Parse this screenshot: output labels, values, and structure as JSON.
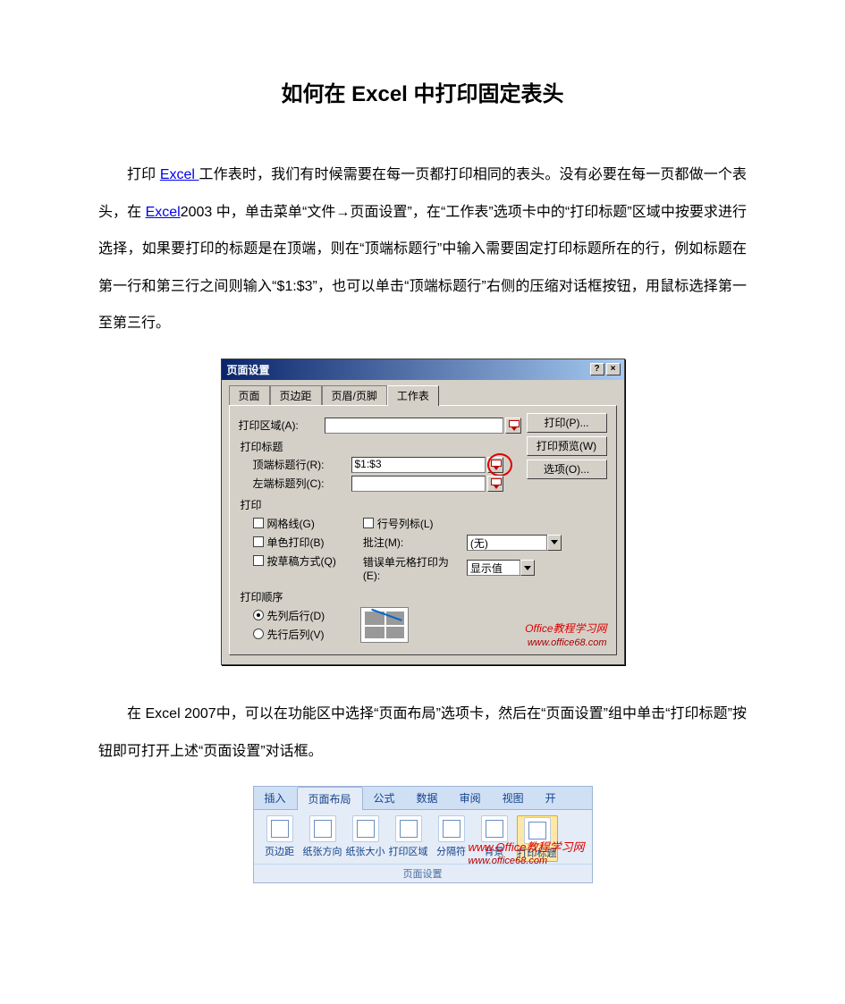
{
  "doc": {
    "title": "如何在 Excel 中打印固定表头",
    "p1_a": "打印 ",
    "p1_link1": "Excel ",
    "p1_b": "工作表时，我们有时候需要在每一页都打印相同的表头。没有必要在每一页都做一个表头，在 ",
    "p1_link2": "Excel",
    "p1_c": "2003 中，单击菜单“文件→页面设置”，在“工作表”选项卡中的“打印标题”区域中按要求进行选择，如果要打印的标题是在顶端，则在“顶端标题行”中输入需要固定打印标题所在的行，例如标题在第一行和第三行之间则输入“$1:$3”，也可以单击“顶端标题行”右侧的压缩对话框按钮，用鼠标选择第一至第三行。",
    "p2": "在 Excel  2007中，可以在功能区中选择“页面布局”选项卡，然后在“页面设置”组中单击“打印标题”按钮即可打开上述“页面设置”对话框。"
  },
  "dialog": {
    "title": "页面设置",
    "help_btn": "?",
    "close_btn": "×",
    "tabs": [
      "页面",
      "页边距",
      "页眉/页脚",
      "工作表"
    ],
    "active_tab": 3,
    "print_area_label": "打印区域(A):",
    "section_titles": "打印标题",
    "top_row_label": "顶端标题行(R):",
    "top_row_value": "$1:$3",
    "left_col_label": "左端标题列(C):",
    "section_print": "打印",
    "cb_grid": "网格线(G)",
    "cb_mono": "单色打印(B)",
    "cb_draft": "按草稿方式(Q)",
    "cb_rowcol": "行号列标(L)",
    "comment_label": "批注(M):",
    "comment_value": "(无)",
    "error_label": "错误单元格打印为(E):",
    "error_value": "显示值",
    "section_order": "打印顺序",
    "radio_down": "先列后行(D)",
    "radio_over": "先行后列(V)",
    "btn_print": "打印(P)...",
    "btn_preview": "打印预览(W)",
    "btn_options": "选项(O)...",
    "watermark_main": "Office教程学习网",
    "watermark_sub": "www.office68.com"
  },
  "ribbon": {
    "tabs": [
      "插入",
      "页面布局",
      "公式",
      "数据",
      "审阅",
      "视图",
      "开"
    ],
    "active_tab": 1,
    "buttons": [
      "页边距",
      "纸张方向",
      "纸张大小",
      "打印区域",
      "分隔符",
      "背景",
      "打印标题"
    ],
    "selected_btn": 6,
    "group_label": "页面设置",
    "watermark_pre": "www.",
    "watermark_main": "Office教程学习网",
    "watermark_sub": "www.office68.com"
  }
}
